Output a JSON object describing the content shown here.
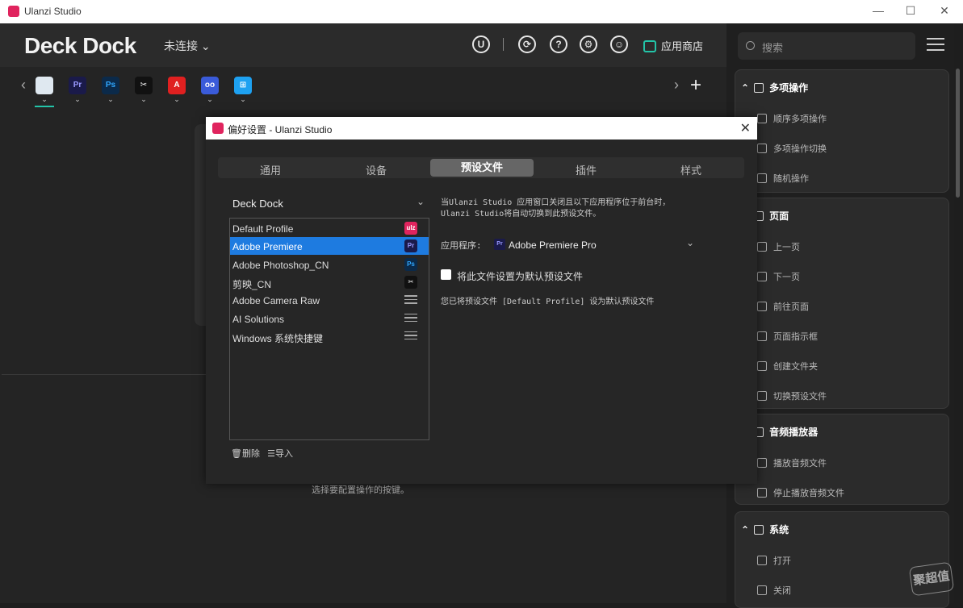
{
  "window": {
    "title": "Ulanzi Studio",
    "minimize": "—",
    "maximize": "☐",
    "close": "✕"
  },
  "header": {
    "brand": "Deck Dock",
    "connection": "未连接",
    "store_label": "应用商店"
  },
  "apps": [
    {
      "name": "finder",
      "label": "",
      "bg": "#dfe8f0",
      "fg": "#333"
    },
    {
      "name": "premiere",
      "label": "Pr",
      "bg": "#1a1a4a",
      "fg": "#9999ff"
    },
    {
      "name": "photoshop",
      "label": "Ps",
      "bg": "#0b2a4a",
      "fg": "#31a8ff"
    },
    {
      "name": "capcut",
      "label": "✂",
      "bg": "#111",
      "fg": "#fff"
    },
    {
      "name": "adobe",
      "label": "A",
      "bg": "#e02020",
      "fg": "#fff"
    },
    {
      "name": "ulanzi",
      "label": "oo",
      "bg": "#3a5bd9",
      "fg": "#fff"
    },
    {
      "name": "windows",
      "label": "⊞",
      "bg": "#1ea1f1",
      "fg": "#fff"
    }
  ],
  "main": {
    "hint": "选择要配置操作的按键。"
  },
  "sidebar": {
    "search_placeholder": "搜索",
    "groups": [
      {
        "title": "多项操作",
        "items": [
          "顺序多项操作",
          "多项操作切换",
          "随机操作"
        ]
      },
      {
        "title": "页面",
        "items": [
          "上一页",
          "下一页",
          "前往页面",
          "页面指示框",
          "创建文件夹",
          "切换预设文件"
        ]
      },
      {
        "title": "音频播放器",
        "items": [
          "播放音频文件",
          "停止播放音频文件"
        ]
      },
      {
        "title": "系统",
        "items": [
          "打开",
          "关闭"
        ]
      }
    ]
  },
  "watermark": "聚超值",
  "dialog": {
    "title": "偏好设置 - Ulanzi Studio",
    "tabs": [
      "通用",
      "设备",
      "预设文件",
      "插件",
      "样式"
    ],
    "device": "Deck Dock",
    "profiles": [
      {
        "label": "Default Profile",
        "icon": "ulanzi-logo",
        "tag": "ulz"
      },
      {
        "label": "Adobe Premiere",
        "icon": "premiere-icon",
        "tag": "Pr"
      },
      {
        "label": "Adobe Photoshop_CN",
        "icon": "photoshop-icon",
        "tag": "Ps"
      },
      {
        "label": "剪映_CN",
        "icon": "capcut-icon",
        "tag": "✂"
      },
      {
        "label": "Adobe Camera Raw",
        "icon": "list-icon",
        "tag": ""
      },
      {
        "label": "AI Solutions",
        "icon": "list-icon",
        "tag": ""
      },
      {
        "label": "Windows 系统快捷键",
        "icon": "list-icon",
        "tag": ""
      }
    ],
    "delete_label": "删除",
    "import_label": "导入",
    "note_line1": "当Ulanzi Studio 应用窗口关闭且以下应用程序位于前台时，",
    "note_line2": "Ulanzi Studio将自动切换到此预设文件。",
    "app_label": "应用程序:",
    "app_value": "Adobe Premiere Pro",
    "checkbox_label": "将此文件设置为默认预设文件",
    "status": "您已将预设文件 [Default Profile] 设为默认预设文件"
  },
  "colors": {
    "accent": "#23c4a8",
    "selection": "#1e7be0",
    "brand_red": "#e0245e"
  }
}
